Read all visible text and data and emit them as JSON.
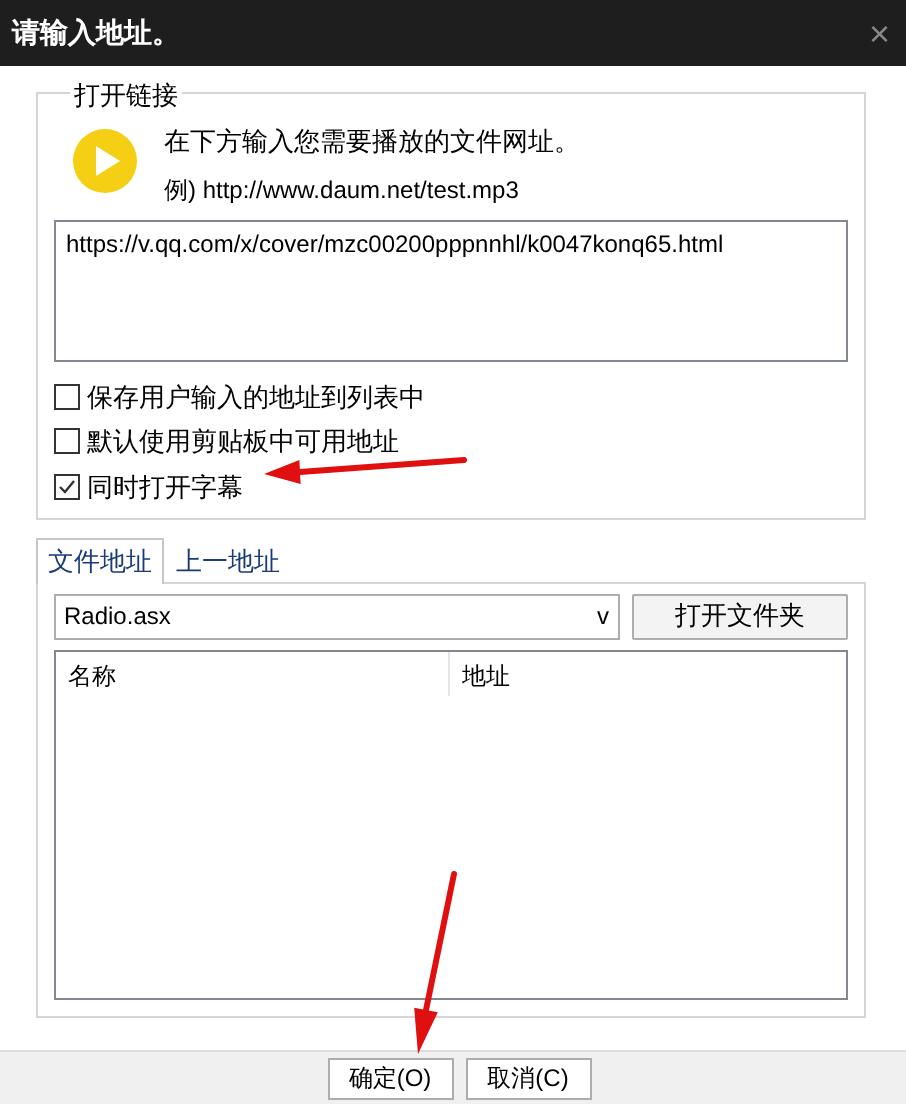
{
  "window": {
    "title": "请输入地址。",
    "close": "×"
  },
  "link_group": {
    "legend": "打开链接",
    "instruction": "在下方输入您需要播放的文件网址。",
    "example": "例) http://www.daum.net/test.mp3",
    "url_value": "https://v.qq.com/x/cover/mzc00200pppnnhl/k0047konq65.html",
    "checkboxes": [
      {
        "label": "保存用户输入的地址到列表中",
        "checked": false
      },
      {
        "label": "默认使用剪贴板中可用地址",
        "checked": false
      },
      {
        "label": "同时打开字幕",
        "checked": true
      }
    ]
  },
  "tabs": [
    {
      "label": "文件地址",
      "selected": true
    },
    {
      "label": "上一地址",
      "selected": false
    }
  ],
  "file_panel": {
    "dropdown_value": "Radio.asx",
    "dropdown_caret": "v",
    "open_folder_button": "打开文件夹",
    "columns": [
      "名称",
      "地址"
    ]
  },
  "buttons": [
    "确定(O)",
    "取消(C)"
  ],
  "annotations": [
    {
      "kind": "arrow"
    },
    {
      "kind": "arrow"
    }
  ]
}
